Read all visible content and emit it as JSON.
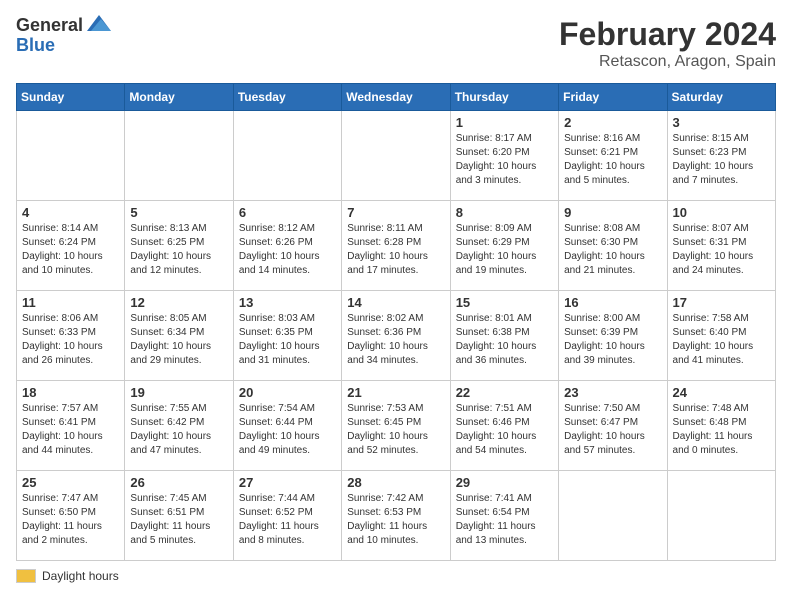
{
  "header": {
    "logo_general": "General",
    "logo_blue": "Blue",
    "month_title": "February 2024",
    "location": "Retascon, Aragon, Spain"
  },
  "days_of_week": [
    "Sunday",
    "Monday",
    "Tuesday",
    "Wednesday",
    "Thursday",
    "Friday",
    "Saturday"
  ],
  "legend": {
    "label": "Daylight hours"
  },
  "weeks": [
    [
      {
        "day": "",
        "info": ""
      },
      {
        "day": "",
        "info": ""
      },
      {
        "day": "",
        "info": ""
      },
      {
        "day": "",
        "info": ""
      },
      {
        "day": "1",
        "info": "Sunrise: 8:17 AM\nSunset: 6:20 PM\nDaylight: 10 hours\nand 3 minutes."
      },
      {
        "day": "2",
        "info": "Sunrise: 8:16 AM\nSunset: 6:21 PM\nDaylight: 10 hours\nand 5 minutes."
      },
      {
        "day": "3",
        "info": "Sunrise: 8:15 AM\nSunset: 6:23 PM\nDaylight: 10 hours\nand 7 minutes."
      }
    ],
    [
      {
        "day": "4",
        "info": "Sunrise: 8:14 AM\nSunset: 6:24 PM\nDaylight: 10 hours\nand 10 minutes."
      },
      {
        "day": "5",
        "info": "Sunrise: 8:13 AM\nSunset: 6:25 PM\nDaylight: 10 hours\nand 12 minutes."
      },
      {
        "day": "6",
        "info": "Sunrise: 8:12 AM\nSunset: 6:26 PM\nDaylight: 10 hours\nand 14 minutes."
      },
      {
        "day": "7",
        "info": "Sunrise: 8:11 AM\nSunset: 6:28 PM\nDaylight: 10 hours\nand 17 minutes."
      },
      {
        "day": "8",
        "info": "Sunrise: 8:09 AM\nSunset: 6:29 PM\nDaylight: 10 hours\nand 19 minutes."
      },
      {
        "day": "9",
        "info": "Sunrise: 8:08 AM\nSunset: 6:30 PM\nDaylight: 10 hours\nand 21 minutes."
      },
      {
        "day": "10",
        "info": "Sunrise: 8:07 AM\nSunset: 6:31 PM\nDaylight: 10 hours\nand 24 minutes."
      }
    ],
    [
      {
        "day": "11",
        "info": "Sunrise: 8:06 AM\nSunset: 6:33 PM\nDaylight: 10 hours\nand 26 minutes."
      },
      {
        "day": "12",
        "info": "Sunrise: 8:05 AM\nSunset: 6:34 PM\nDaylight: 10 hours\nand 29 minutes."
      },
      {
        "day": "13",
        "info": "Sunrise: 8:03 AM\nSunset: 6:35 PM\nDaylight: 10 hours\nand 31 minutes."
      },
      {
        "day": "14",
        "info": "Sunrise: 8:02 AM\nSunset: 6:36 PM\nDaylight: 10 hours\nand 34 minutes."
      },
      {
        "day": "15",
        "info": "Sunrise: 8:01 AM\nSunset: 6:38 PM\nDaylight: 10 hours\nand 36 minutes."
      },
      {
        "day": "16",
        "info": "Sunrise: 8:00 AM\nSunset: 6:39 PM\nDaylight: 10 hours\nand 39 minutes."
      },
      {
        "day": "17",
        "info": "Sunrise: 7:58 AM\nSunset: 6:40 PM\nDaylight: 10 hours\nand 41 minutes."
      }
    ],
    [
      {
        "day": "18",
        "info": "Sunrise: 7:57 AM\nSunset: 6:41 PM\nDaylight: 10 hours\nand 44 minutes."
      },
      {
        "day": "19",
        "info": "Sunrise: 7:55 AM\nSunset: 6:42 PM\nDaylight: 10 hours\nand 47 minutes."
      },
      {
        "day": "20",
        "info": "Sunrise: 7:54 AM\nSunset: 6:44 PM\nDaylight: 10 hours\nand 49 minutes."
      },
      {
        "day": "21",
        "info": "Sunrise: 7:53 AM\nSunset: 6:45 PM\nDaylight: 10 hours\nand 52 minutes."
      },
      {
        "day": "22",
        "info": "Sunrise: 7:51 AM\nSunset: 6:46 PM\nDaylight: 10 hours\nand 54 minutes."
      },
      {
        "day": "23",
        "info": "Sunrise: 7:50 AM\nSunset: 6:47 PM\nDaylight: 10 hours\nand 57 minutes."
      },
      {
        "day": "24",
        "info": "Sunrise: 7:48 AM\nSunset: 6:48 PM\nDaylight: 11 hours\nand 0 minutes."
      }
    ],
    [
      {
        "day": "25",
        "info": "Sunrise: 7:47 AM\nSunset: 6:50 PM\nDaylight: 11 hours\nand 2 minutes."
      },
      {
        "day": "26",
        "info": "Sunrise: 7:45 AM\nSunset: 6:51 PM\nDaylight: 11 hours\nand 5 minutes."
      },
      {
        "day": "27",
        "info": "Sunrise: 7:44 AM\nSunset: 6:52 PM\nDaylight: 11 hours\nand 8 minutes."
      },
      {
        "day": "28",
        "info": "Sunrise: 7:42 AM\nSunset: 6:53 PM\nDaylight: 11 hours\nand 10 minutes."
      },
      {
        "day": "29",
        "info": "Sunrise: 7:41 AM\nSunset: 6:54 PM\nDaylight: 11 hours\nand 13 minutes."
      },
      {
        "day": "",
        "info": ""
      },
      {
        "day": "",
        "info": ""
      }
    ]
  ]
}
